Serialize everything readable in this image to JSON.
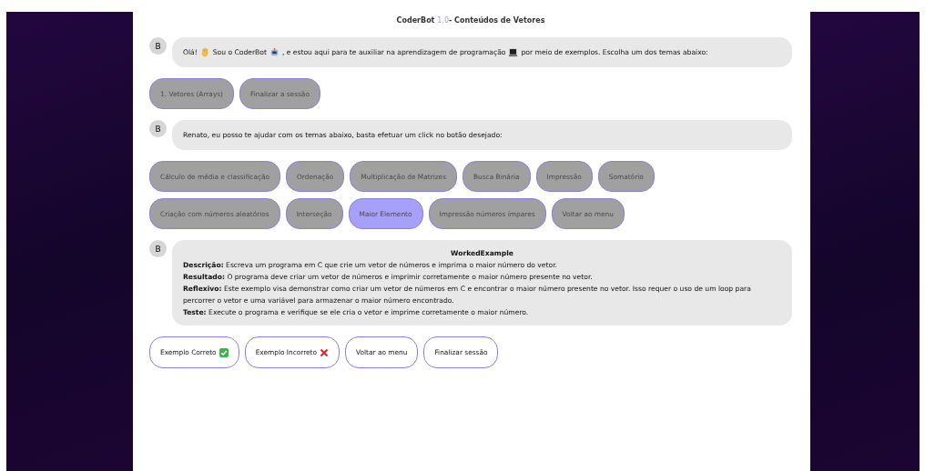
{
  "header": {
    "name": "CoderBot",
    "version": "1.0",
    "title": "- Conteúdos de Vetores"
  },
  "messages": [
    {
      "kind": "greeting",
      "avatar": "B",
      "parts": [
        "Olá!",
        "Sou o CoderBot",
        ", e estou aqui para te auxiliar na aprendizagem de programação",
        "por meio de exemplos. Escolha um dos temas abaixo:"
      ],
      "options": [
        [
          {
            "label": "1. Vetores (Arrays)",
            "selected": false
          },
          {
            "label": "Finalizar a sessão",
            "selected": false
          }
        ]
      ]
    },
    {
      "kind": "text",
      "avatar": "B",
      "text": "Renato, eu posso te ajudar com os temas abaixo, basta efetuar um click no botão desejado:",
      "options": [
        [
          {
            "label": "Cálculo de média e classificação",
            "selected": false
          },
          {
            "label": "Ordenação",
            "selected": false
          },
          {
            "label": "Multiplicação de Matrizes",
            "selected": false
          },
          {
            "label": "Busca Binária",
            "selected": false
          },
          {
            "label": "Impressão",
            "selected": false
          },
          {
            "label": "Somatório",
            "selected": false
          }
        ],
        [
          {
            "label": "Criação com números aleatórios",
            "selected": false
          },
          {
            "label": "Interseção",
            "selected": false
          },
          {
            "label": "Maior Elemento",
            "selected": true
          },
          {
            "label": "Impressão números ímpares",
            "selected": false
          },
          {
            "label": "Voltar ao menu",
            "selected": false
          }
        ]
      ]
    },
    {
      "kind": "example",
      "avatar": "B",
      "title": "WorkedExample",
      "lines": [
        "**Descrição:** Escreva um programa em C que crie um vetor de números e imprima o maior número do vetor.",
        "**Resultado:** O programa deve criar um vetor de números e imprimir corretamente o maior número presente no vetor.",
        "**Reflexivo:** Este exemplo visa demonstrar como criar um vetor de números em C e encontrar o maior número presente no vetor. Isso requer o uso de um loop para percorrer o vetor e uma variável para armazenar o maior número encontrado.",
        "**Teste:** Execute o programa e verifique se ele cria o vetor e imprime corretamente o maior número."
      ],
      "actions": [
        "Exemplo Correto",
        "Exemplo Incorreto",
        "Voltar ao menu",
        "Finalizar sessão"
      ]
    }
  ]
}
